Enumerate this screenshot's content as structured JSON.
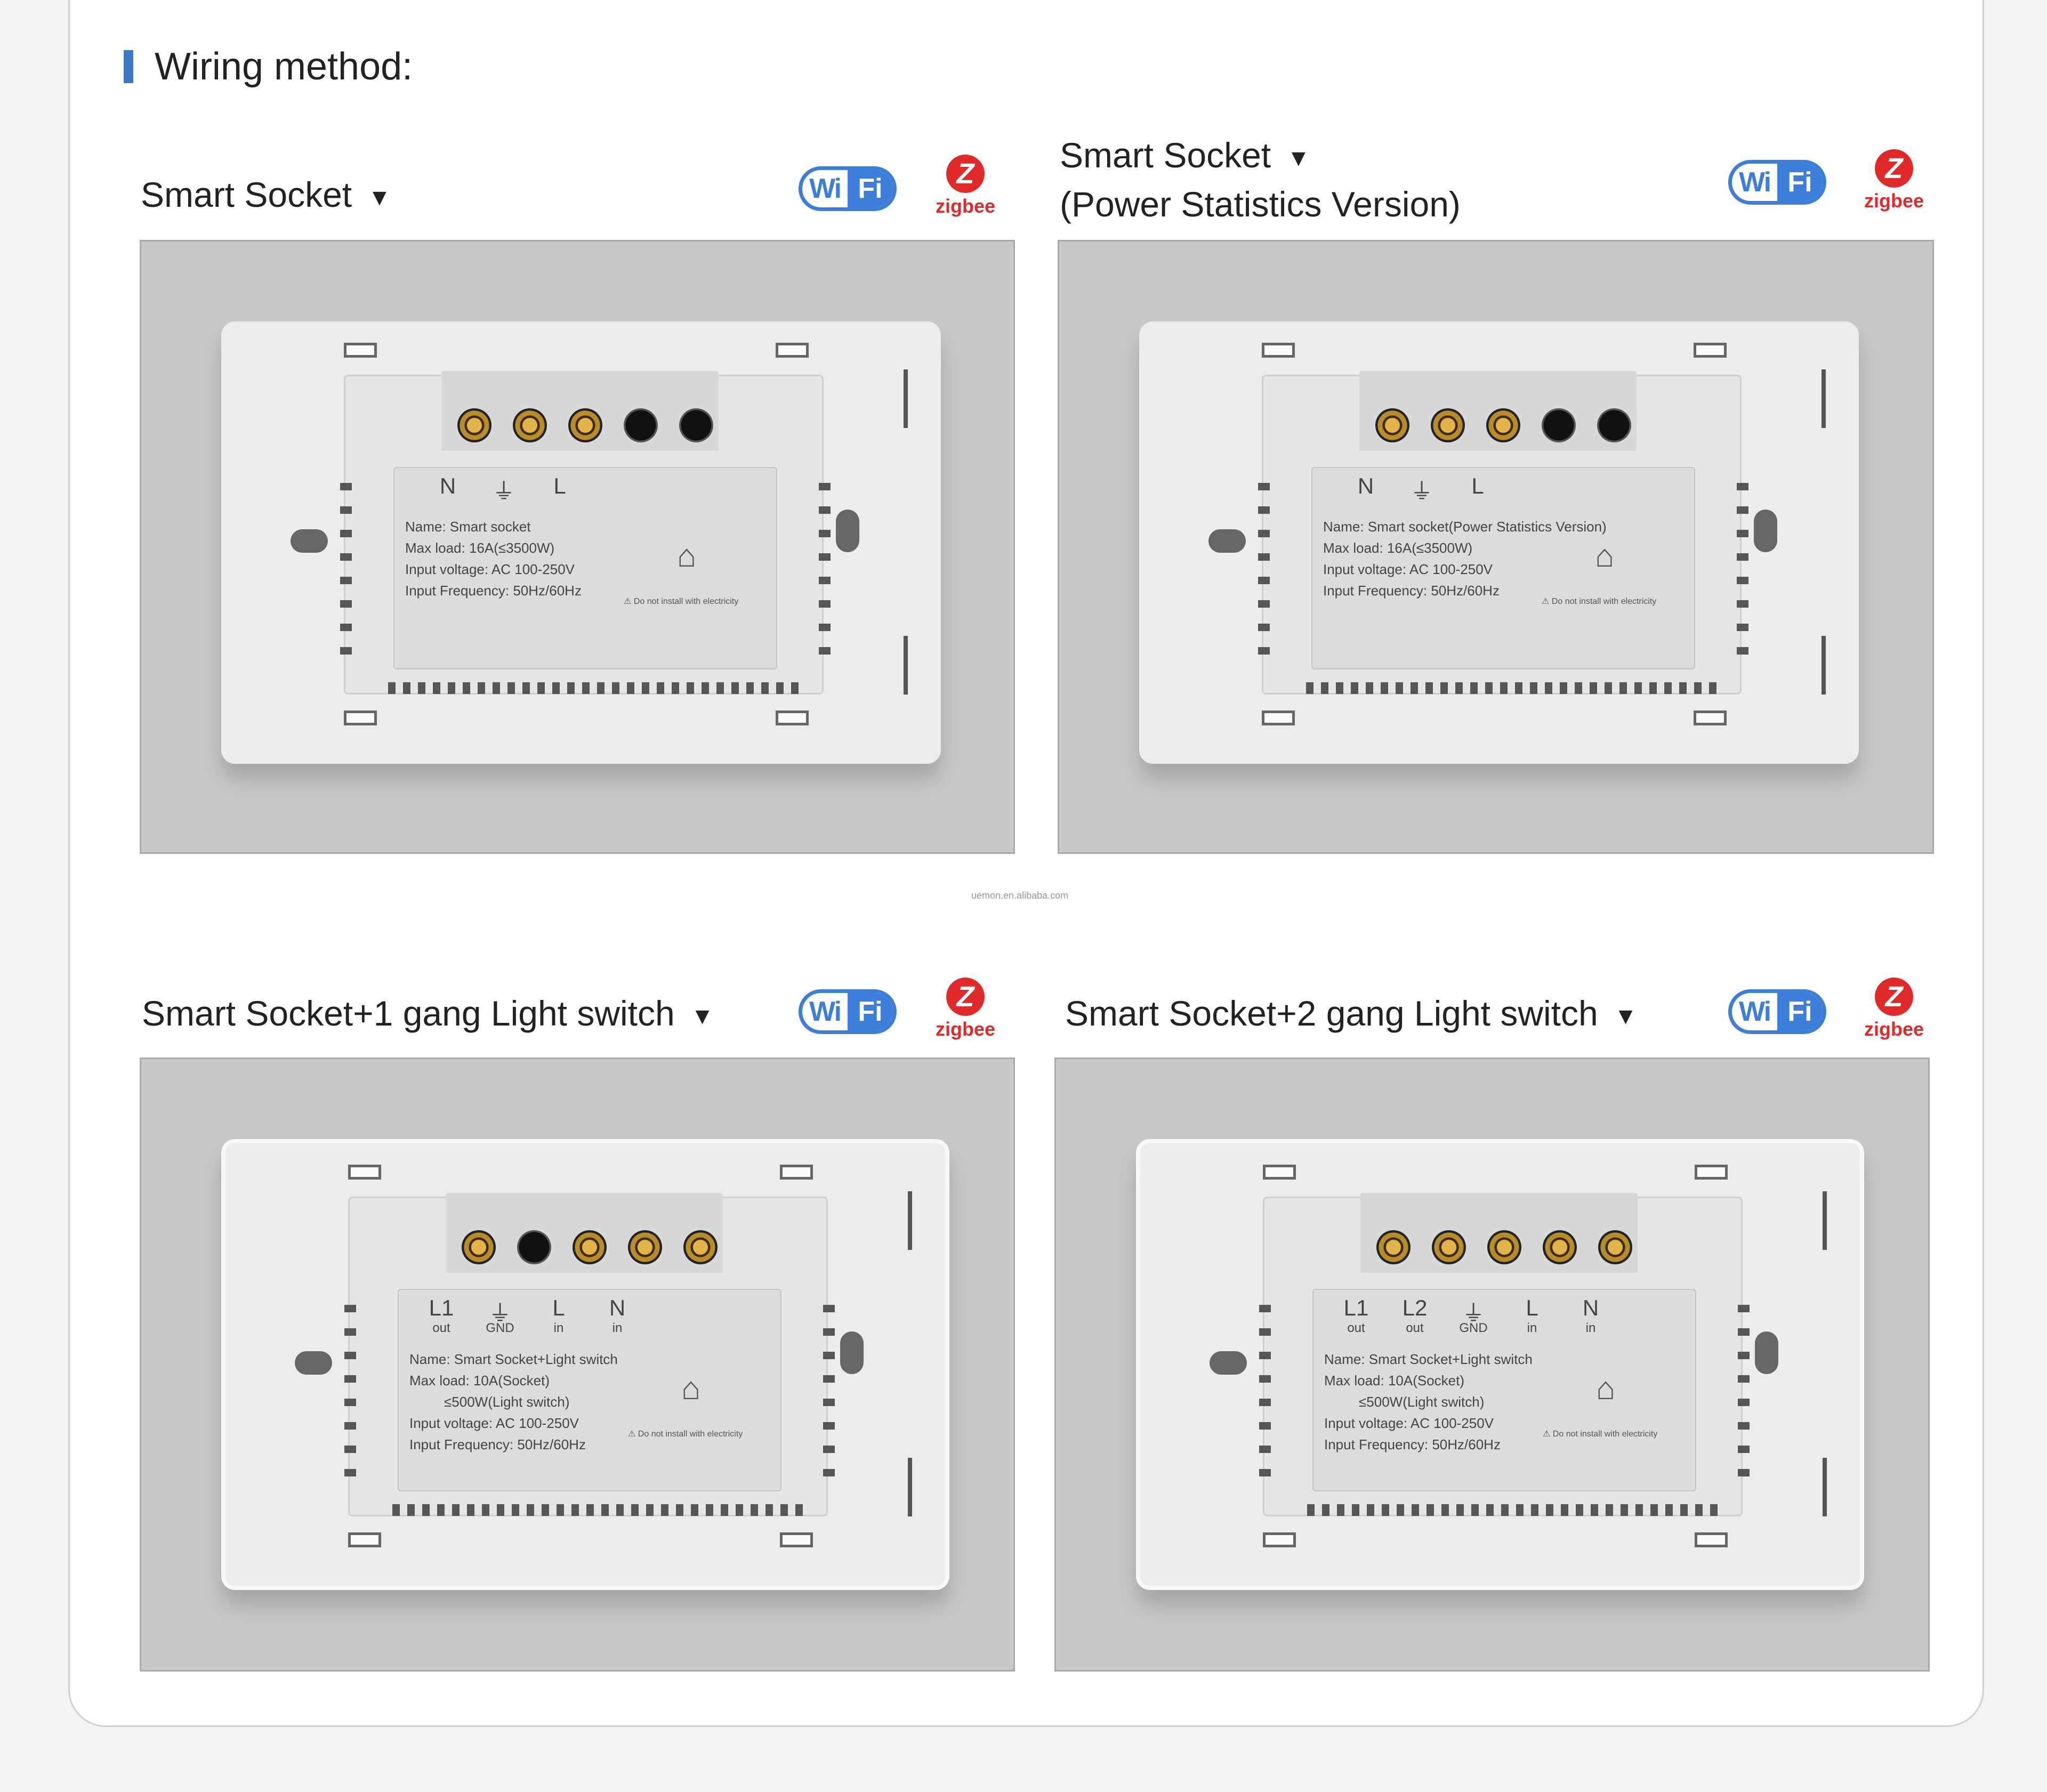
{
  "section_title": "Wiring method:",
  "panels": [
    {
      "heading": "Smart Socket",
      "heading_line2": "",
      "triangle": "▼",
      "wifi": {
        "w": "Wi",
        "f": "Fi"
      },
      "zigbee": {
        "glyph": "Z",
        "label": "zigbee"
      },
      "product": {
        "terminals": [
          "brass",
          "brass",
          "brass",
          "dark",
          "dark"
        ],
        "symbols": [
          "N",
          "⏚",
          "L"
        ],
        "symbol_sub": [],
        "spec": "Name: Smart socket\nMax load: 16A(≤3500W)\nInput voltage: AC 100-250V\nInput Frequency: 50Hz/60Hz",
        "warning": "⚠ Do not install with electricity"
      }
    },
    {
      "heading": "Smart Socket",
      "heading_line2": "(Power Statistics Version)",
      "triangle": "▼",
      "wifi": {
        "w": "Wi",
        "f": "Fi"
      },
      "zigbee": {
        "glyph": "Z",
        "label": "zigbee"
      },
      "product": {
        "terminals": [
          "brass",
          "brass",
          "brass",
          "dark",
          "dark"
        ],
        "symbols": [
          "N",
          "⏚",
          "L"
        ],
        "symbol_sub": [],
        "spec": "Name: Smart socket(Power Statistics Version)\nMax load: 16A(≤3500W)\nInput voltage: AC 100-250V\nInput Frequency: 50Hz/60Hz",
        "warning": "⚠ Do not install with electricity"
      }
    },
    {
      "heading": "Smart Socket+1 gang Light switch",
      "heading_line2": "",
      "triangle": "▼",
      "wifi": {
        "w": "Wi",
        "f": "Fi"
      },
      "zigbee": {
        "glyph": "Z",
        "label": "zigbee"
      },
      "product": {
        "terminals": [
          "brass",
          "dark",
          "brass",
          "brass",
          "brass"
        ],
        "symbols": [
          "L1",
          "⏚",
          "L",
          "N"
        ],
        "symbol_sub": [
          "out",
          "GND",
          "in",
          "in"
        ],
        "spec": "Name: Smart Socket+Light switch\nMax load: 10A(Socket)\n         ≤500W(Light switch)\nInput voltage: AC 100-250V\nInput Frequency: 50Hz/60Hz",
        "warning": "⚠ Do not install with electricity"
      }
    },
    {
      "heading": "Smart Socket+2 gang Light switch",
      "heading_line2": "",
      "triangle": "▼",
      "wifi": {
        "w": "Wi",
        "f": "Fi"
      },
      "zigbee": {
        "glyph": "Z",
        "label": "zigbee"
      },
      "product": {
        "terminals": [
          "brass",
          "brass",
          "brass",
          "brass",
          "brass"
        ],
        "symbols": [
          "L1",
          "L2",
          "⏚",
          "L",
          "N"
        ],
        "symbol_sub": [
          "out",
          "out",
          "GND",
          "in",
          "in"
        ],
        "spec": "Name: Smart Socket+Light switch\nMax load: 10A(Socket)\n         ≤500W(Light switch)\nInput voltage: AC 100-250V\nInput Frequency: 50Hz/60Hz",
        "warning": "⚠ Do not install with electricity"
      }
    }
  ],
  "footer_watermark": "uemon.en.alibaba.com"
}
